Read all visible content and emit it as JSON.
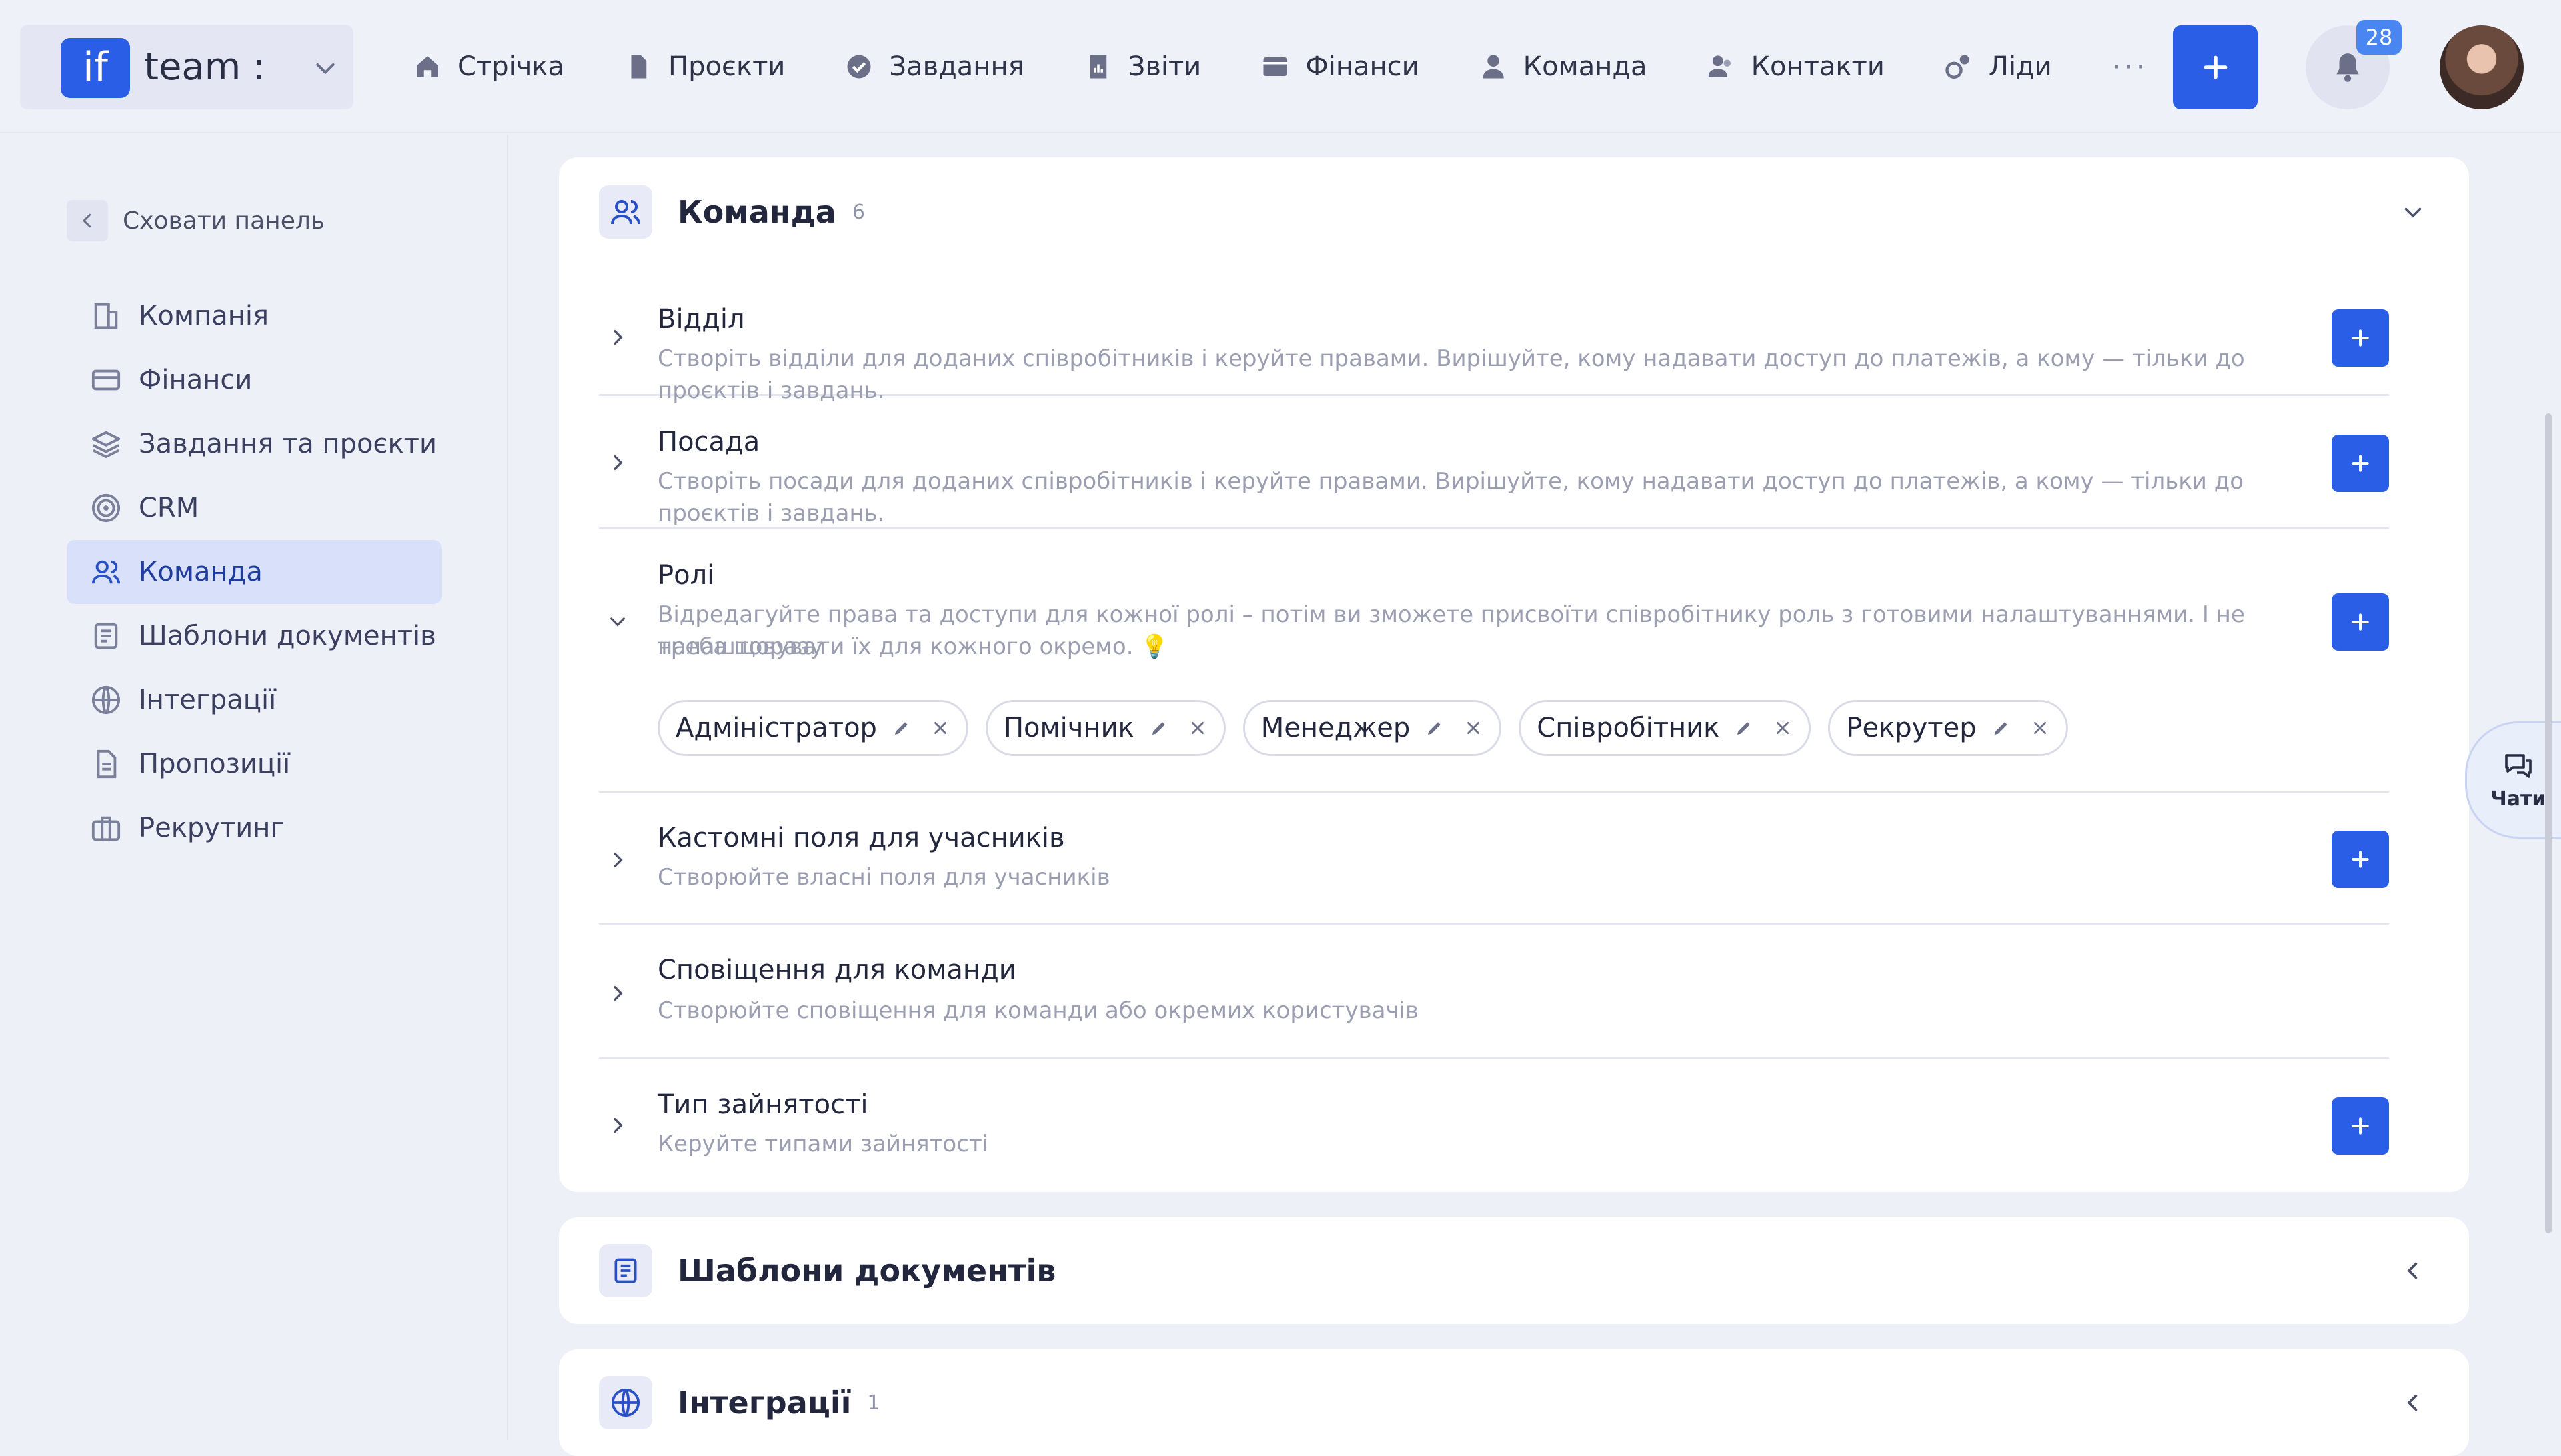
{
  "header": {
    "logo_text": "if",
    "workspace_name": "team :",
    "nav": [
      {
        "label": "Стрічка",
        "icon": "home-icon"
      },
      {
        "label": "Проєкти",
        "icon": "document-icon"
      },
      {
        "label": "Завдання",
        "icon": "check-circle-icon"
      },
      {
        "label": "Звіти",
        "icon": "report-icon"
      },
      {
        "label": "Фінанси",
        "icon": "wallet-icon"
      },
      {
        "label": "Команда",
        "icon": "person-icon"
      },
      {
        "label": "Контакти",
        "icon": "contacts-icon"
      },
      {
        "label": "Ліди",
        "icon": "leads-icon"
      }
    ],
    "more_label": "···",
    "notifications_count": "28"
  },
  "sidebar": {
    "hide_label": "Сховати панель",
    "items": [
      {
        "label": "Компанія",
        "icon": "company-icon"
      },
      {
        "label": "Фінанси",
        "icon": "card-icon"
      },
      {
        "label": "Завдання та проєкти",
        "icon": "layers-icon"
      },
      {
        "label": "CRM",
        "icon": "target-icon"
      },
      {
        "label": "Команда",
        "icon": "team-icon",
        "active": true
      },
      {
        "label": "Шаблони документів",
        "icon": "template-icon"
      },
      {
        "label": "Інтеграції",
        "icon": "globe-icon"
      },
      {
        "label": "Пропозиції",
        "icon": "proposal-icon"
      },
      {
        "label": "Рекрутинг",
        "icon": "briefcase-icon"
      }
    ]
  },
  "team_card": {
    "title": "Команда",
    "count": "6",
    "sections": [
      {
        "title": "Відділ",
        "desc": "Створіть відділи для доданих співробітників і керуйте правами. Вирішуйте, кому надавати доступ до платежів, а кому — тільки до проєктів і завдань."
      },
      {
        "title": "Посада",
        "desc": "Створіть посади для доданих співробітників і керуйте правами. Вирішуйте, кому надавати доступ до платежів, а кому — тільки до проєктів і завдань."
      },
      {
        "title": "Ролі",
        "desc_line1": "Відредагуйте права та доступи для кожної ролі – потім ви зможете присвоїти співробітнику роль з готовими налаштуваннями. І не треба щоразу",
        "desc_line2": "налаштовувати їх для кожного окремо. 💡"
      },
      {
        "title": "Кастомні поля для учасників",
        "desc": "Створюйте власні поля для учасників"
      },
      {
        "title": "Сповіщення для команди",
        "desc": "Створюйте сповіщення для команди або окремих користувачів"
      },
      {
        "title": "Тип зайнятості",
        "desc": "Керуйте типами зайнятості"
      }
    ],
    "roles": [
      "Адміністратор",
      "Помічник",
      "Менеджер",
      "Співробітник",
      "Рекрутер"
    ]
  },
  "templates_card": {
    "title": "Шаблони документів"
  },
  "integrations_card": {
    "title": "Інтеграції",
    "count": "1"
  },
  "chat": {
    "label": "Чати"
  },
  "colors": {
    "accent": "#2b5ee6",
    "background": "#eef0f8",
    "active_item": "#d9e1fa"
  }
}
